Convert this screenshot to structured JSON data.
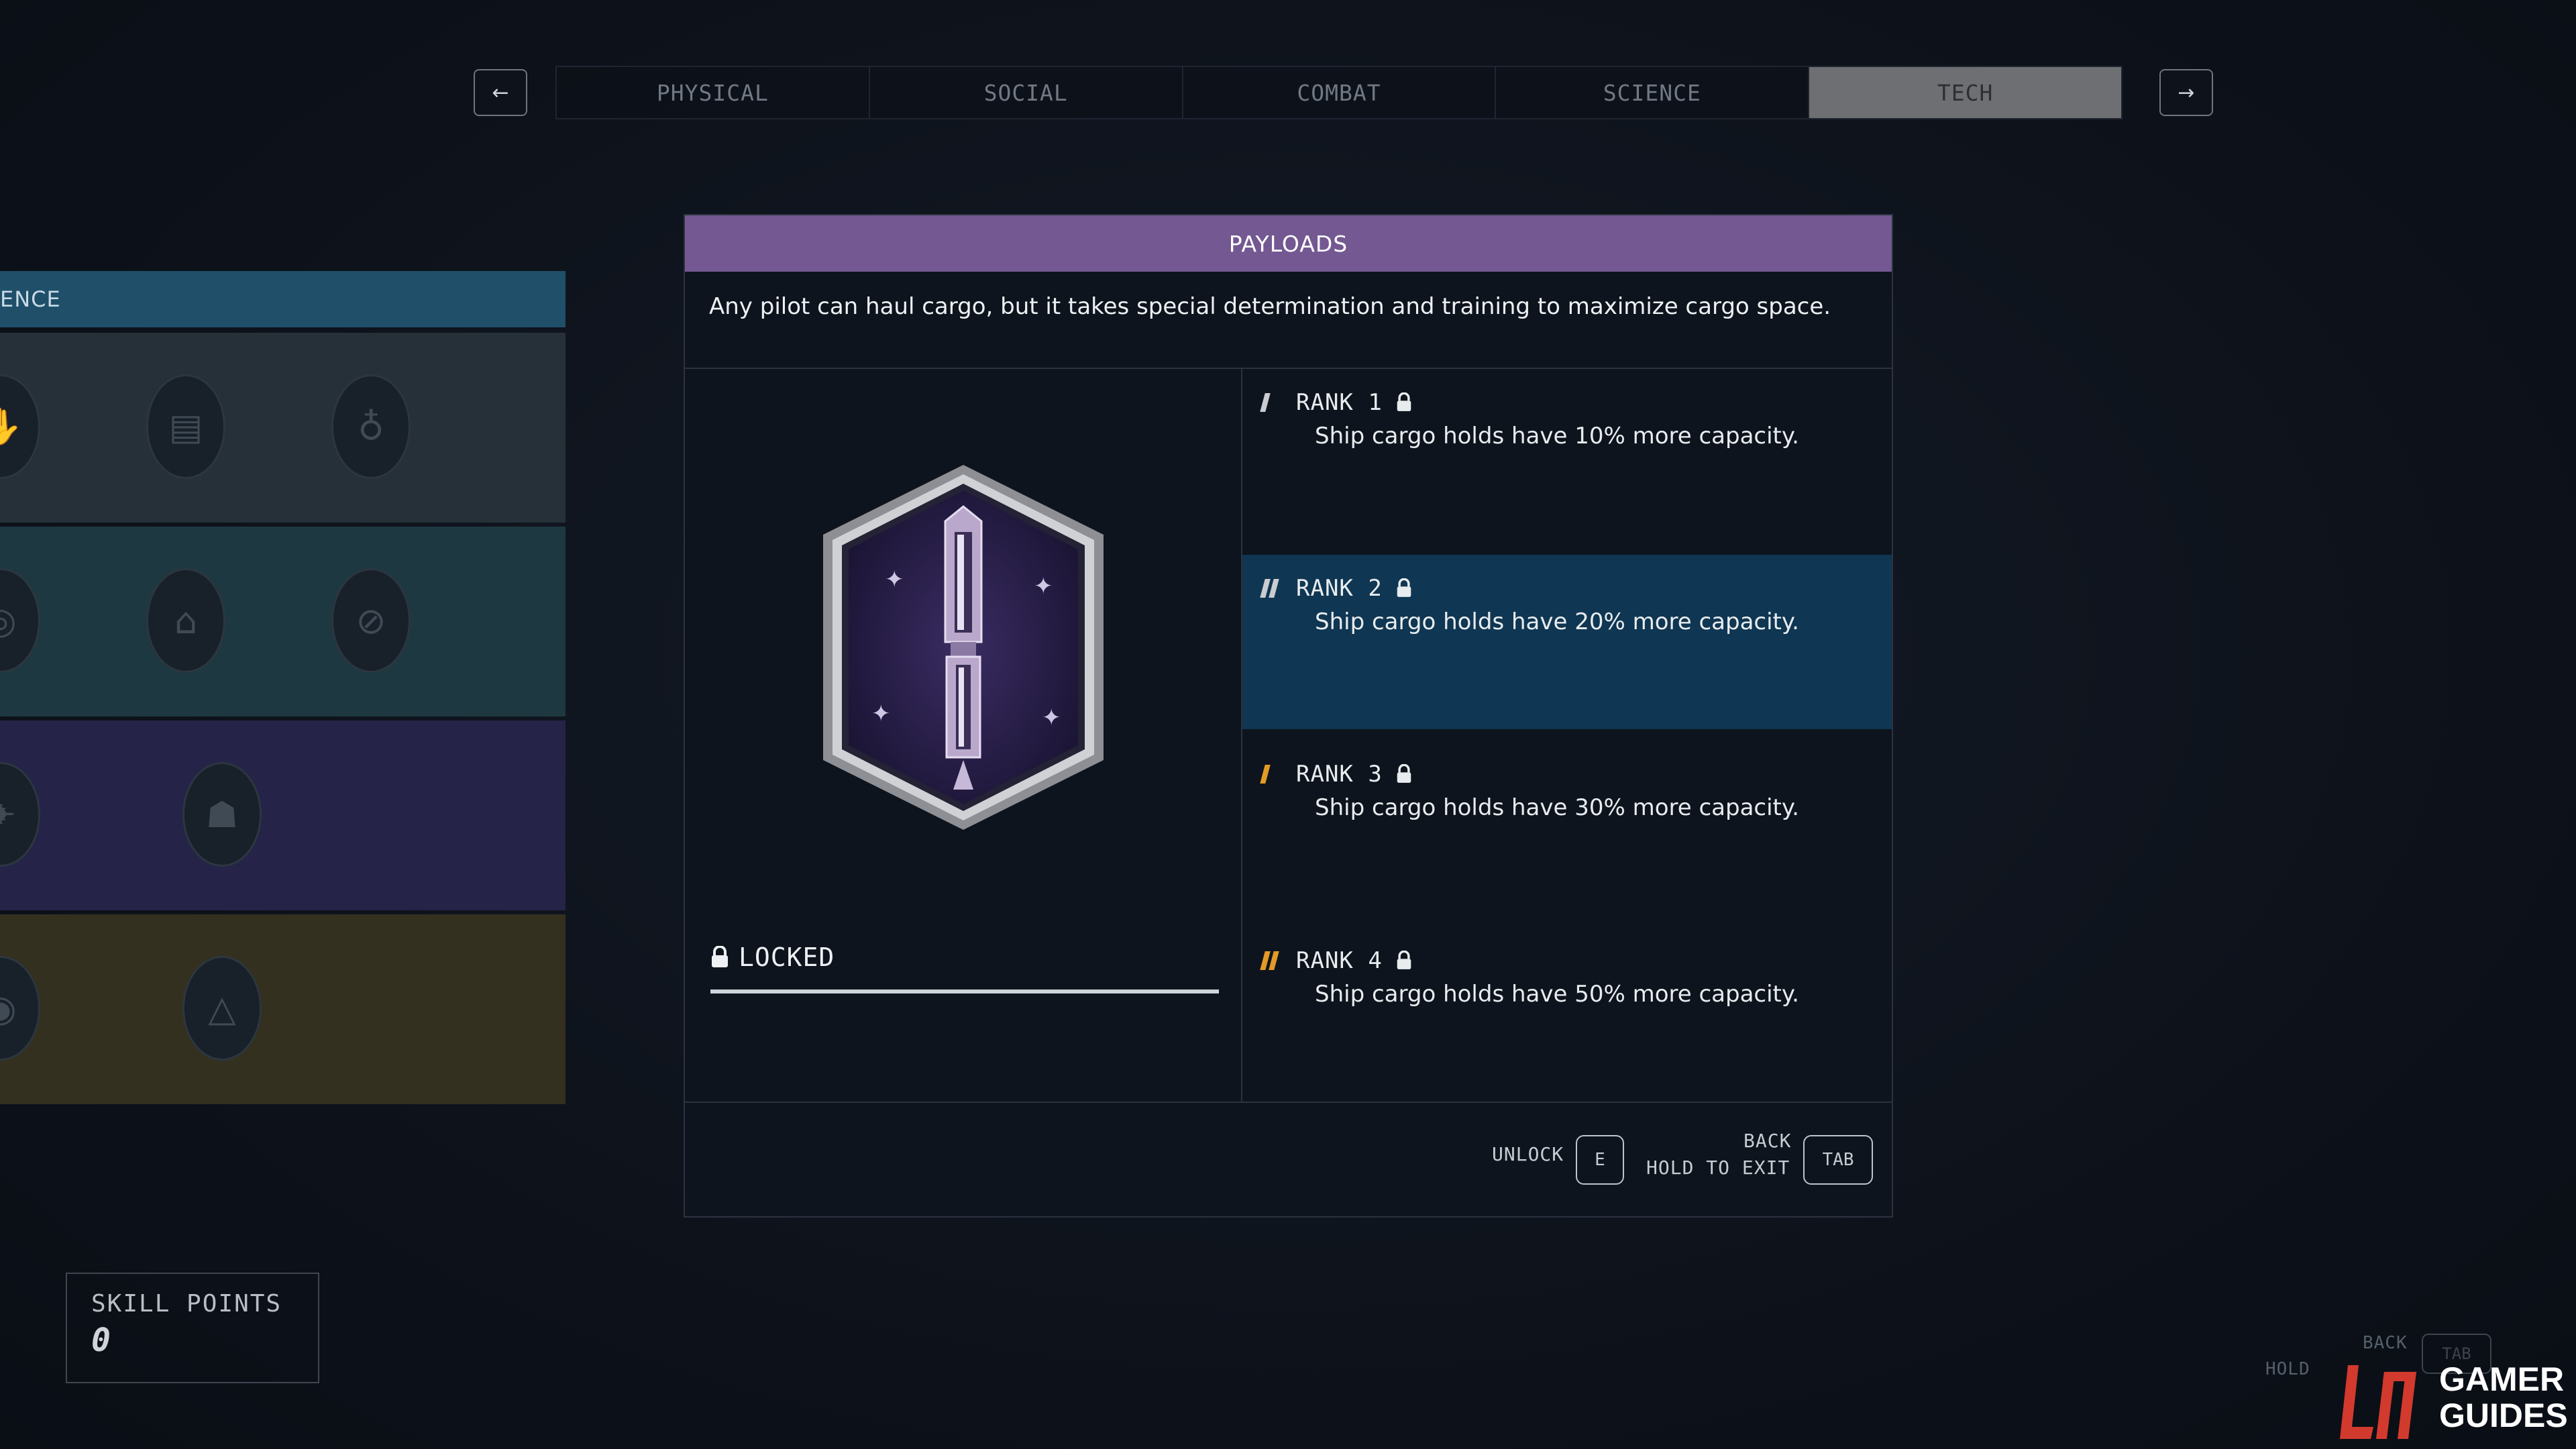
{
  "nav": {
    "prev_icon": "arrow-left",
    "next_icon": "arrow-right",
    "prev_glyph": "←",
    "next_glyph": "→",
    "tabs": [
      {
        "label": "PHYSICAL"
      },
      {
        "label": "SOCIAL"
      },
      {
        "label": "COMBAT"
      },
      {
        "label": "SCIENCE"
      },
      {
        "label": "TECH"
      }
    ],
    "active_tab": "TECH"
  },
  "tree": {
    "header": "ENCE",
    "row_colors": [
      "#253038",
      "#1d3840",
      "#262348",
      "#34301f"
    ]
  },
  "skill": {
    "title": "PAYLOADS",
    "description": "Any pilot can haul cargo, but it takes special determination and training to maximize cargo space.",
    "status": "LOCKED",
    "ranks": [
      {
        "label": "RANK 1",
        "description": "Ship cargo holds have 10% more capacity.",
        "color": "#c9ccd1"
      },
      {
        "label": "RANK 2",
        "description": "Ship cargo holds have 20% more capacity.",
        "color": "#c9ccd1"
      },
      {
        "label": "RANK 3",
        "description": "Ship cargo holds have 30% more capacity.",
        "color": "#e39a27"
      },
      {
        "label": "RANK 4",
        "description": "Ship cargo holds have 50% more capacity.",
        "color": "#e39a27"
      }
    ],
    "selected_rank": 2,
    "title_color": "#735892"
  },
  "footer": {
    "unlock_label": "UNLOCK",
    "unlock_key": "E",
    "back_label": "BACK",
    "exit_label": "HOLD TO EXIT",
    "back_key": "TAB"
  },
  "skill_points": {
    "label": "SKILL POINTS",
    "value": "0"
  },
  "background_hints": {
    "back": "BACK",
    "hold": "HOLD",
    "tab": "TAB"
  },
  "watermark": {
    "line1": "GAMER",
    "line2": "GUIDES"
  }
}
